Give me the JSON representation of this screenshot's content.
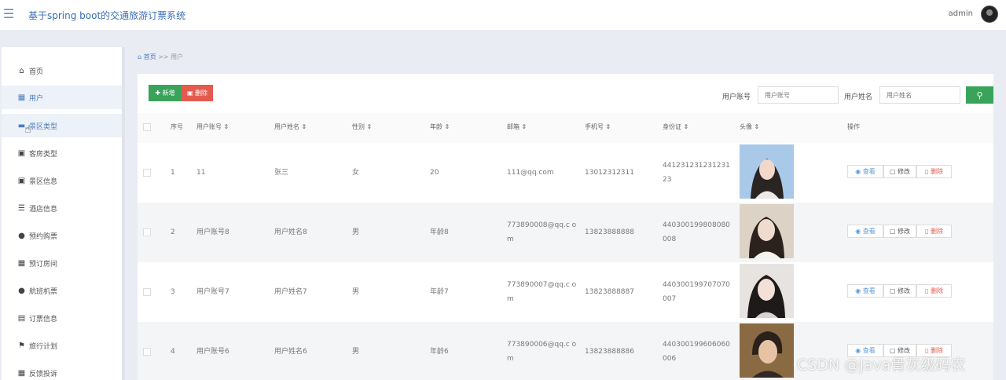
{
  "header": {
    "title": "基于spring boot的交通旅游订票系统",
    "user": "admin"
  },
  "sidebar": {
    "items": [
      {
        "label": "首页",
        "icon": "home-icon"
      },
      {
        "label": "用户",
        "icon": "grid-icon"
      },
      {
        "label": "景区类型",
        "icon": "monitor-icon"
      },
      {
        "label": "客房类型",
        "icon": "clipboard-icon"
      },
      {
        "label": "景区信息",
        "icon": "clipboard-icon"
      },
      {
        "label": "酒店信息",
        "icon": "sliders-icon"
      },
      {
        "label": "预约购票",
        "icon": "user-icon"
      },
      {
        "label": "预订房间",
        "icon": "grid-icon"
      },
      {
        "label": "航班机票",
        "icon": "user-icon"
      },
      {
        "label": "订票信息",
        "icon": "document-icon"
      },
      {
        "label": "旅行计划",
        "icon": "flag-icon"
      },
      {
        "label": "反馈投诉",
        "icon": "grid-icon"
      }
    ]
  },
  "breadcrumb": {
    "home": "首页",
    "separator": ">>",
    "current": "用户"
  },
  "toolbar": {
    "add_label": "新增",
    "delete_label": "删除"
  },
  "search": {
    "account_label": "用户账号",
    "account_placeholder": "用户账号",
    "name_label": "用户姓名",
    "name_placeholder": "用户姓名"
  },
  "table": {
    "columns": [
      "序号",
      "用户账号 ⇕",
      "用户姓名 ⇕",
      "性别 ⇕",
      "年龄 ⇕",
      "邮箱 ⇕",
      "手机号 ⇕",
      "身份证 ⇕",
      "头像 ⇕",
      "操作"
    ],
    "rows": [
      {
        "index": "1",
        "account": "11",
        "name": "张三",
        "gender": "女",
        "age": "20",
        "email": "111@qq.com",
        "phone": "13012312311",
        "id_card": "441231231231231 23"
      },
      {
        "index": "2",
        "account": "用户账号8",
        "name": "用户姓名8",
        "gender": "男",
        "age": "年龄8",
        "email": "773890008@qq.c om",
        "phone": "13823888888",
        "id_card": "440300199808080 008"
      },
      {
        "index": "3",
        "account": "用户账号7",
        "name": "用户姓名7",
        "gender": "男",
        "age": "年龄7",
        "email": "773890007@qq.c om",
        "phone": "13823888887",
        "id_card": "440300199707070 007"
      },
      {
        "index": "4",
        "account": "用户账号6",
        "name": "用户姓名6",
        "gender": "男",
        "age": "年龄6",
        "email": "773890006@qq.c om",
        "phone": "13823888886",
        "id_card": "440300199606060 006"
      }
    ],
    "actions": {
      "view": "查看",
      "edit": "修改",
      "delete": "删除"
    }
  },
  "watermark": "CSDN @Java骨灰级码农",
  "colors": {
    "primary": "#4b7bc0",
    "success": "#3aa35a",
    "danger": "#e55a4f"
  }
}
